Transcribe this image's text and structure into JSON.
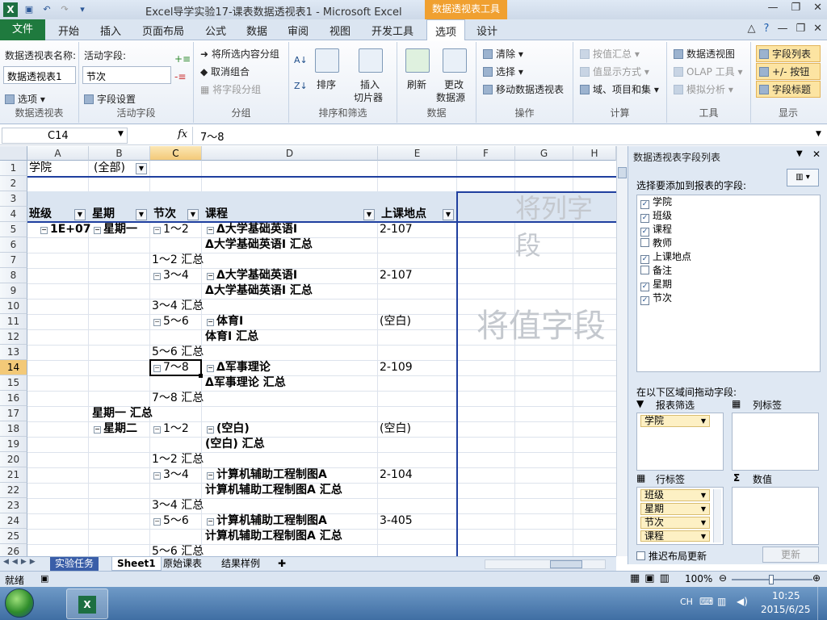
{
  "window": {
    "title": "Excel导学实验17-课表数据透视表1 - Microsoft Excel",
    "context_tab": "数据透视表工具"
  },
  "ribbon_tabs": [
    "文件",
    "开始",
    "插入",
    "页面布局",
    "公式",
    "数据",
    "审阅",
    "视图",
    "开发工具",
    "选项",
    "设计"
  ],
  "ribbon": {
    "pivot_name_label": "数据透视表名称:",
    "pivot_name_value": "数据透视表1",
    "options_label": "选项",
    "group_pivottable": "数据透视表",
    "active_field_label": "活动字段:",
    "active_field_value": "节次",
    "field_settings": "字段设置",
    "group_active_field": "活动字段",
    "group_selection": "将所选内容分组",
    "ungroup": "取消组合",
    "group_field": "将字段分组",
    "group_group": "分组",
    "sort": "排序",
    "insert_slicer_1": "插入",
    "insert_slicer_2": "切片器",
    "group_sort": "排序和筛选",
    "refresh": "刷新",
    "change_source_1": "更改",
    "change_source_2": "数据源",
    "group_data": "数据",
    "clear": "清除",
    "select": "选择",
    "move_pivot": "移动数据透视表",
    "group_actions": "操作",
    "summarize_by": "按值汇总",
    "show_values_as": "值显示方式",
    "fields_items": "域、项目和集",
    "group_calc": "计算",
    "pivot_chart": "数据透视图",
    "olap_tools": "OLAP 工具",
    "what_if": "模拟分析",
    "group_tools": "工具",
    "field_list": "字段列表",
    "buttons": "+/- 按钮",
    "field_headers": "字段标题",
    "group_show": "显示"
  },
  "formula_bar": {
    "name_box": "C14",
    "fx": "fx",
    "formula": "7～8"
  },
  "columns": [
    "A",
    "B",
    "C",
    "D",
    "E",
    "F",
    "G",
    "H"
  ],
  "rows": [
    "1",
    "2",
    "3",
    "4",
    "5",
    "6",
    "7",
    "8",
    "9",
    "10",
    "11",
    "12",
    "13",
    "14",
    "15",
    "16",
    "17",
    "18",
    "19",
    "20",
    "21",
    "22",
    "23",
    "24",
    "25",
    "26"
  ],
  "pivot": {
    "filter_label": "学院",
    "filter_value": "(全部)",
    "hdr_class": "班级",
    "hdr_weekday": "星期",
    "hdr_period": "节次",
    "hdr_course": "课程",
    "hdr_location": "上课地点",
    "drop_col_hint": "将列字段",
    "drop_val_hint": "将值字段",
    "r5_a": "1E+07",
    "r5_b": "星期一",
    "r5_c": "1～2",
    "r5_d": "Δ大学基础英语Ⅰ",
    "r5_e": "2-107",
    "r6_d": "Δ大学基础英语Ⅰ 汇总",
    "r7_c": "1～2 汇总",
    "r8_c": "3～4",
    "r8_d": "Δ大学基础英语Ⅰ",
    "r8_e": "2-107",
    "r9_d": "Δ大学基础英语Ⅰ 汇总",
    "r10_c": "3～4 汇总",
    "r11_c": "5～6",
    "r11_d": "体育Ⅰ",
    "r11_e": "(空白)",
    "r12_d": "体育Ⅰ 汇总",
    "r13_c": "5～6 汇总",
    "r14_c": "7～8",
    "r14_d": "Δ军事理论",
    "r14_e": "2-109",
    "r15_d": "Δ军事理论 汇总",
    "r16_c": "7～8 汇总",
    "r17_b": "星期一 汇总",
    "r18_b": "星期二",
    "r18_c": "1～2",
    "r18_d": "(空白)",
    "r18_e": "(空白)",
    "r19_d": "(空白) 汇总",
    "r20_c": "1～2 汇总",
    "r21_c": "3～4",
    "r21_d": "计算机辅助工程制图A",
    "r21_e": "2-104",
    "r22_d": "计算机辅助工程制图A 汇总",
    "r23_c": "3～4 汇总",
    "r24_c": "5～6",
    "r24_d": "计算机辅助工程制图A",
    "r24_e": "3-405",
    "r25_d": "计算机辅助工程制图A 汇总",
    "r26_c": "5～6 汇总"
  },
  "field_panel": {
    "title": "数据透视表字段列表",
    "choose_label": "选择要添加到报表的字段:",
    "fields": [
      {
        "name": "学院",
        "checked": "✓"
      },
      {
        "name": "班级",
        "checked": "✓"
      },
      {
        "name": "课程",
        "checked": "✓"
      },
      {
        "name": "教师",
        "checked": ""
      },
      {
        "name": "上课地点",
        "checked": "✓"
      },
      {
        "name": "备注",
        "checked": ""
      },
      {
        "name": "星期",
        "checked": "✓"
      },
      {
        "name": "节次",
        "checked": "✓"
      }
    ],
    "drag_label": "在以下区域间拖动字段:",
    "report_filter": "报表筛选",
    "column_labels": "列标签",
    "row_labels": "行标签",
    "values": "数值",
    "filter_items": [
      "学院"
    ],
    "row_items": [
      "班级",
      "星期",
      "节次",
      "课程"
    ],
    "defer_label": "推迟布局更新",
    "update_btn": "更新"
  },
  "sheet_tabs": [
    "实验任务",
    "Sheet1",
    "原始课表",
    "结果样例"
  ],
  "status": {
    "ready": "就绪",
    "zoom": "100%"
  },
  "taskbar": {
    "lang": "CH",
    "time": "10:25",
    "date": "2015/6/25"
  },
  "colors": {
    "excel_green": "#1f7a3e",
    "context_orange": "#f0a030",
    "active_cell": "#000000",
    "pivot_border": "#1f3f9f"
  }
}
